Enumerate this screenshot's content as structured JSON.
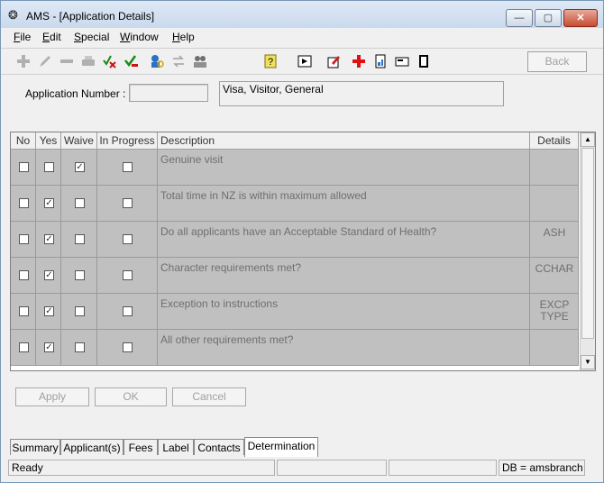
{
  "window": {
    "title": "AMS - [Application Details]",
    "controls": {
      "minimize": "—",
      "maximize": "▢",
      "close": "✕"
    }
  },
  "menu": [
    "File",
    "Edit",
    "Special",
    "Window",
    "Help"
  ],
  "menu_underline": [
    "F",
    "E",
    "S",
    "W",
    "H"
  ],
  "toolbar": {
    "back_label": "Back",
    "icons": [
      "add-icon",
      "edit-icon",
      "remove-icon",
      "print-icon",
      "approve-reject-icon",
      "approve-icon",
      "search-person-icon",
      "transfer-icon",
      "people-icon",
      "help-icon",
      "forward-icon",
      "document-edit-icon",
      "medical-cross-icon",
      "report-icon",
      "card-icon",
      "notebook-icon"
    ]
  },
  "application": {
    "number_label": "Application Number :",
    "number_value": "",
    "type": "Visa, Visitor, General"
  },
  "grid": {
    "columns": [
      "No",
      "Yes",
      "Waive",
      "In Progress",
      "Description",
      "Details"
    ],
    "rows": [
      {
        "no": false,
        "yes": false,
        "waive": true,
        "in_progress": false,
        "description": "Genuine visit",
        "details": ""
      },
      {
        "no": false,
        "yes": true,
        "waive": false,
        "in_progress": false,
        "description": "Total time in NZ is within maximum allowed",
        "details": ""
      },
      {
        "no": false,
        "yes": true,
        "waive": false,
        "in_progress": false,
        "description": "Do all applicants have an Acceptable Standard of Health?",
        "details": "ASH"
      },
      {
        "no": false,
        "yes": true,
        "waive": false,
        "in_progress": false,
        "description": "Character requirements met?",
        "details": "CCHAR"
      },
      {
        "no": false,
        "yes": true,
        "waive": false,
        "in_progress": false,
        "description": "Exception to instructions",
        "details": "EXCP TYPE"
      },
      {
        "no": false,
        "yes": true,
        "waive": false,
        "in_progress": false,
        "description": "All other requirements met?",
        "details": ""
      }
    ]
  },
  "buttons": {
    "apply": "Apply",
    "ok": "OK",
    "cancel": "Cancel"
  },
  "tabs": [
    {
      "label": "Summary",
      "active": false
    },
    {
      "label": "Applicant(s)",
      "active": false
    },
    {
      "label": "Fees",
      "active": false
    },
    {
      "label": "Label",
      "active": false
    },
    {
      "label": "Contacts",
      "active": false
    },
    {
      "label": "Determination",
      "active": true
    }
  ],
  "status": {
    "message": "Ready",
    "db": "DB = amsbranch"
  }
}
